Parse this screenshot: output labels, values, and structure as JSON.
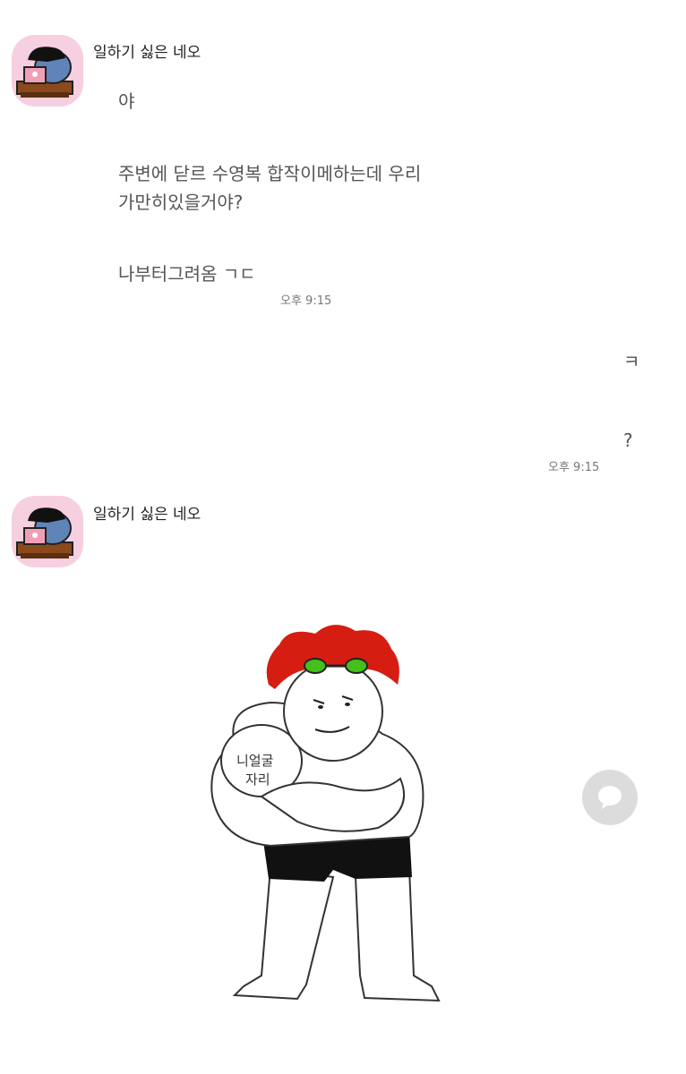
{
  "chat": {
    "messages_group_1": {
      "sender": "일하기 싫은 네오",
      "lines": [
        "야",
        "주변에 닫르 수영복 합작이메하는데 우리",
        "가만히있을거야?",
        "나부터그려옴 ㄱㄷ"
      ],
      "time": "오후 9:15"
    },
    "my_messages": {
      "lines": [
        "ㅋ",
        "?"
      ],
      "time": "오후 9:15"
    },
    "messages_group_2": {
      "sender": "일하기 싫은 네오",
      "image_caption": [
        "니얼굴",
        "자리"
      ]
    }
  },
  "icons": {
    "avatar": "neo-character-avatar",
    "share_button": "speech-bubble-icon"
  },
  "colors": {
    "avatar_bg": "#f6cfe0",
    "button_bg": "#dcdcdc",
    "hair": "#d61d12",
    "goggles": "#43c01a"
  }
}
